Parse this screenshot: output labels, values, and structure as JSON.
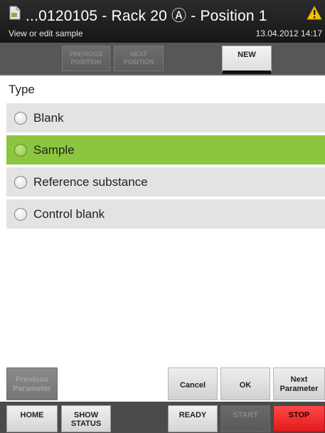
{
  "header": {
    "title": "...0120105 - Rack 20 Ⓐ - Position 1",
    "subtitle": "View or edit sample",
    "datetime": "13.04.2012 14:17",
    "icons": {
      "document": "document-icon",
      "warning": "warning-icon"
    },
    "warning_color": "#f5c400"
  },
  "toolbar": {
    "previous_position_label": "PREVIOUS POSITION",
    "next_position_label": "NEXT POSITION",
    "new_label": "NEW"
  },
  "type_section": {
    "heading": "Type",
    "options": [
      {
        "label": "Blank",
        "selected": false
      },
      {
        "label": "Sample",
        "selected": true
      },
      {
        "label": "Reference substance",
        "selected": false
      },
      {
        "label": "Control blank",
        "selected": false
      }
    ],
    "selected_color": "#8cc63f"
  },
  "param_bar": {
    "previous_parameter_label": "Previous Parameter",
    "cancel_label": "Cancel",
    "ok_label": "OK",
    "next_parameter_label": "Next Parameter"
  },
  "status_bar": {
    "home_label": "HOME",
    "show_status_label": "SHOW STATUS",
    "ready_label": "READY",
    "start_label": "START",
    "stop_label": "STOP",
    "stop_color": "#ff3030"
  }
}
